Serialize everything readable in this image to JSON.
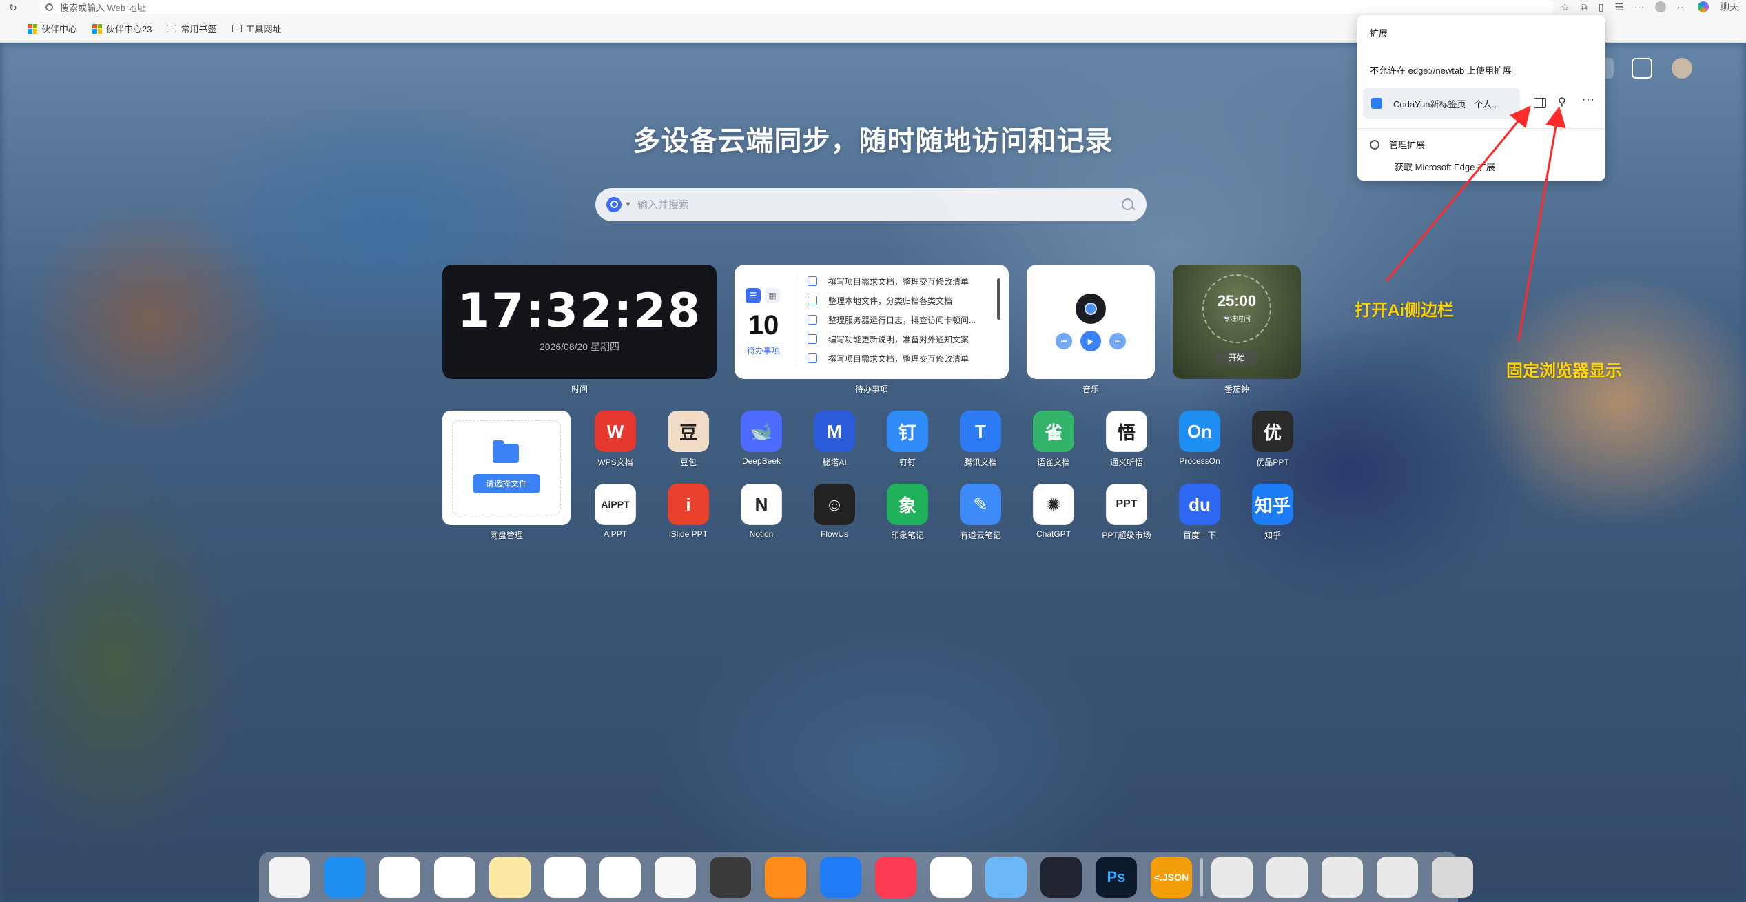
{
  "browser": {
    "address_placeholder": "搜索或输入 Web 地址",
    "right_label": "聊天",
    "bookmarks": [
      "伙伴中心",
      "伙伴中心23",
      "常用书签",
      "工具网址"
    ]
  },
  "extensions_popup": {
    "title": "扩展",
    "note": "不允许在 edge://newtab 上使用扩展",
    "extension_name": "CodaYun新标签页 - 个人...",
    "manage": "管理扩展",
    "get": "获取 Microsoft Edge 扩展"
  },
  "headline": "多设备云端同步，随时随地访问和记录",
  "search": {
    "placeholder": "输入并搜索"
  },
  "widgets": {
    "clock": {
      "time": "17:32:28",
      "date": "2026/08/20 星期四",
      "label": "时间"
    },
    "todo": {
      "count": "10",
      "count_label": "待办事项",
      "label": "待办事项",
      "items": [
        "撰写项目需求文档，整理交互修改清单",
        "整理本地文件，分类归档各类文档",
        "整理服务器运行日志，排查访问卡顿问...",
        "编写功能更新说明，准备对外通知文案",
        "撰写项目需求文档，整理交互修改清单"
      ]
    },
    "music": {
      "label": "音乐"
    },
    "pomodoro": {
      "time": "25:00",
      "subtitle": "专注时间",
      "start": "开始",
      "label": "番茄钟"
    }
  },
  "netdisk": {
    "button": "请选择文件",
    "label": "网盘管理"
  },
  "apps_row1": [
    {
      "name": "WPS文档",
      "glyph": "W",
      "color": "#e6372f"
    },
    {
      "name": "豆包",
      "glyph": "豆",
      "color": "#f3dcc6"
    },
    {
      "name": "DeepSeek",
      "glyph": "🐋",
      "color": "#4d6bfe"
    },
    {
      "name": "秘塔AI",
      "glyph": "M",
      "color": "#2b5bd8"
    },
    {
      "name": "钉钉",
      "glyph": "钉",
      "color": "#2f8bf6"
    },
    {
      "name": "腾讯文档",
      "glyph": "T",
      "color": "#2e7bf6"
    },
    {
      "name": "语雀文档",
      "glyph": "雀",
      "color": "#34b36b"
    },
    {
      "name": "通义听悟",
      "glyph": "悟",
      "color": "#ffffff"
    },
    {
      "name": "ProcessOn",
      "glyph": "On",
      "color": "#1f8ef1"
    },
    {
      "name": "优品PPT",
      "glyph": "优",
      "color": "#2a2a2a"
    }
  ],
  "apps_row2": [
    {
      "name": "AiPPT",
      "glyph": "AiPPT",
      "color": "#ffffff"
    },
    {
      "name": "iSlide PPT",
      "glyph": "i",
      "color": "#e8412c"
    },
    {
      "name": "Notion",
      "glyph": "N",
      "color": "#ffffff"
    },
    {
      "name": "FlowUs",
      "glyph": "☺",
      "color": "#222222"
    },
    {
      "name": "印象笔记",
      "glyph": "象",
      "color": "#1fb25a"
    },
    {
      "name": "有道云笔记",
      "glyph": "✎",
      "color": "#3e8bf7"
    },
    {
      "name": "ChatGPT",
      "glyph": "✺",
      "color": "#ffffff"
    },
    {
      "name": "PPT超级市场",
      "glyph": "PPT",
      "color": "#ffffff"
    },
    {
      "name": "百度一下",
      "glyph": "du",
      "color": "#2d67f2"
    },
    {
      "name": "知乎",
      "glyph": "知乎",
      "color": "#1c7cf4"
    }
  ],
  "annotations": {
    "sidebar": "打开Ai侧边栏",
    "pin": "固定浏览器显示"
  },
  "dock": [
    {
      "name": "launchpad",
      "color": "#f2f2f2"
    },
    {
      "name": "app-store",
      "color": "#1f8ef1"
    },
    {
      "name": "icloud",
      "color": "#ffffff"
    },
    {
      "name": "photos",
      "color": "#ffffff"
    },
    {
      "name": "notes",
      "color": "#fbe9a4"
    },
    {
      "name": "reminders",
      "color": "#ffffff"
    },
    {
      "name": "calendar",
      "color": "#ffffff"
    },
    {
      "name": "keychain",
      "color": "#f7f7f7"
    },
    {
      "name": "wallet",
      "color": "#3a3a3a"
    },
    {
      "name": "alarm",
      "color": "#ff8c1a"
    },
    {
      "name": "player",
      "color": "#1f7cf4"
    },
    {
      "name": "music",
      "color": "#fb3b52"
    },
    {
      "name": "safari",
      "color": "#ffffff"
    },
    {
      "name": "pencil",
      "color": "#6fb8f7"
    },
    {
      "name": "dna",
      "color": "#1f2430"
    },
    {
      "name": "photoshop",
      "color": "#0d1a2e"
    },
    {
      "name": "json",
      "color": "#f59e0b"
    },
    {
      "name": "add",
      "color": "#e9e9e9"
    },
    {
      "name": "puzzle",
      "color": "#e9e9e9"
    },
    {
      "name": "brush",
      "color": "#e9e9e9"
    },
    {
      "name": "clock-settings",
      "color": "#e9e9e9"
    },
    {
      "name": "settings",
      "color": "#d9d9d9"
    }
  ],
  "dock_json_label": "<.JSON",
  "dock_ps_label": "Ps"
}
